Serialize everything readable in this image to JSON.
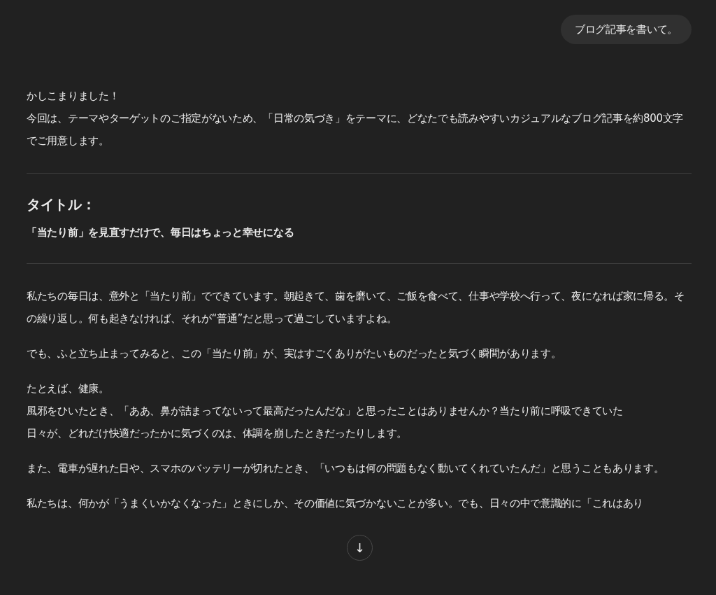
{
  "user_message": "ブログ記事を書いて。",
  "intro": {
    "lines": [
      "かしこまりました！",
      "今回は、テーマやターゲットのご指定がないため、「日常の気づき」をテーマに、どなたでも読みやすいカジュアルなブログ記事を約800文字でご用意します。"
    ]
  },
  "title_section": {
    "heading": "タイトル：",
    "title": "「当たり前」を見直すだけで、毎日はちょっと幸せになる"
  },
  "body": [
    {
      "lines": [
        "私たちの毎日は、意外と「当たり前」でできています。朝起きて、歯を磨いて、ご飯を食べて、仕事や学校へ行って、夜になれば家に帰る。その繰り返し。何も起きなければ、それが“普通”だと思って過ごしていますよね。"
      ]
    },
    {
      "lines": [
        "でも、ふと立ち止まってみると、この「当たり前」が、実はすごくありがたいものだったと気づく瞬間があります。"
      ]
    },
    {
      "lines": [
        "たとえば、健康。",
        "風邪をひいたとき、「ああ、鼻が詰まってないって最高だったんだな」と思ったことはありませんか？当たり前に呼吸できていた",
        "日々が、どれだけ快適だったかに気づくのは、体調を崩したときだったりします。"
      ]
    },
    {
      "lines": [
        "また、電車が遅れた日や、スマホのバッテリーが切れたとき、「いつもは何の問題もなく動いてくれていたんだ」と思うこともあります。"
      ]
    },
    {
      "lines": [
        "私たちは、何かが「うまくいかなくなった」ときにしか、その価値に気づかないことが多い。でも、日々の中で意識的に「これはあり"
      ]
    }
  ],
  "scroll_button": {
    "label": "↓"
  }
}
